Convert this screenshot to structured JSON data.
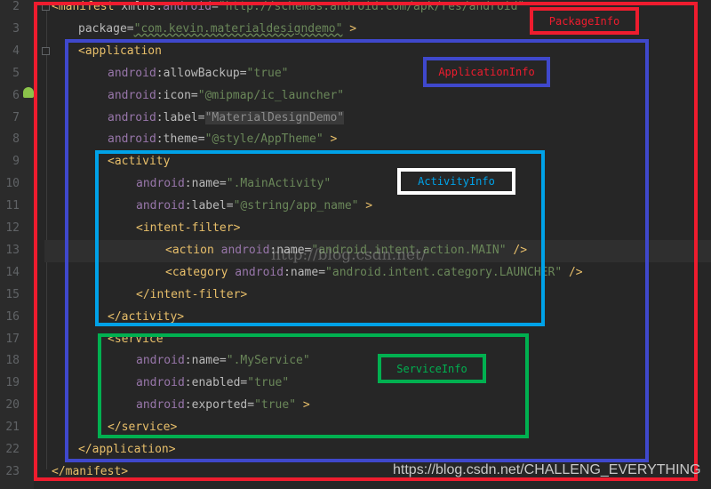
{
  "editor": {
    "lines": [
      {
        "num": "2",
        "indent": 0,
        "tokens": [
          [
            "tag",
            "<manifest "
          ],
          [
            "attr",
            "xmlns:"
          ],
          [
            "ns",
            "android"
          ],
          [
            "attr",
            "="
          ],
          [
            "val",
            "\"http://schemas.android.com/apk/res/android\""
          ]
        ]
      },
      {
        "num": "3",
        "indent": 1,
        "tokens": [
          [
            "attr",
            "package="
          ],
          [
            "val",
            "\"com.kevin.materialdesigndemo\""
          ],
          [
            "tag",
            " >"
          ]
        ]
      },
      {
        "num": "4",
        "indent": 1,
        "tokens": [
          [
            "tag",
            "<application"
          ]
        ]
      },
      {
        "num": "5",
        "indent": 2,
        "tokens": [
          [
            "ns",
            "android"
          ],
          [
            "attr",
            ":allowBackup="
          ],
          [
            "val",
            "\"true\""
          ]
        ]
      },
      {
        "num": "6",
        "indent": 2,
        "tokens": [
          [
            "ns",
            "android"
          ],
          [
            "attr",
            ":icon="
          ],
          [
            "val",
            "\"@mipmap/ic_launcher\""
          ]
        ]
      },
      {
        "num": "7",
        "indent": 2,
        "tokens": [
          [
            "ns",
            "android"
          ],
          [
            "attr",
            ":label="
          ],
          [
            "valgrey",
            "\"MaterialDesignDemo\""
          ]
        ]
      },
      {
        "num": "8",
        "indent": 2,
        "tokens": [
          [
            "ns",
            "android"
          ],
          [
            "attr",
            ":theme="
          ],
          [
            "val",
            "\"@style/AppTheme\""
          ],
          [
            "tag",
            " >"
          ]
        ]
      },
      {
        "num": "9",
        "indent": 2,
        "tokens": [
          [
            "tag",
            "<activity"
          ]
        ]
      },
      {
        "num": "10",
        "indent": 3,
        "tokens": [
          [
            "ns",
            "android"
          ],
          [
            "attr",
            ":name="
          ],
          [
            "val",
            "\".MainActivity\""
          ]
        ]
      },
      {
        "num": "11",
        "indent": 3,
        "tokens": [
          [
            "ns",
            "android"
          ],
          [
            "attr",
            ":label="
          ],
          [
            "val",
            "\"@string/app_name\""
          ],
          [
            "tag",
            " >"
          ]
        ]
      },
      {
        "num": "12",
        "indent": 3,
        "tokens": [
          [
            "tag",
            "<intent-filter>"
          ]
        ]
      },
      {
        "num": "13",
        "indent": 4,
        "tokens": [
          [
            "tag",
            "<action "
          ],
          [
            "ns",
            "android"
          ],
          [
            "attr",
            ":name="
          ],
          [
            "val",
            "\"android.intent.action.MAIN\""
          ],
          [
            "tag",
            " />"
          ]
        ]
      },
      {
        "num": "14",
        "indent": 4,
        "tokens": [
          [
            "tag",
            "<category "
          ],
          [
            "ns",
            "android"
          ],
          [
            "attr",
            ":name="
          ],
          [
            "val",
            "\"android.intent.category.LAUNCHER\""
          ],
          [
            "tag",
            " />"
          ]
        ]
      },
      {
        "num": "15",
        "indent": 3,
        "tokens": [
          [
            "tag",
            "</intent-filter>"
          ]
        ]
      },
      {
        "num": "16",
        "indent": 2,
        "tokens": [
          [
            "tag",
            "</activity>"
          ]
        ]
      },
      {
        "num": "17",
        "indent": 2,
        "tokens": [
          [
            "tag",
            "<service"
          ]
        ]
      },
      {
        "num": "18",
        "indent": 3,
        "tokens": [
          [
            "ns",
            "android"
          ],
          [
            "attr",
            ":name="
          ],
          [
            "val",
            "\".MyService\""
          ]
        ]
      },
      {
        "num": "19",
        "indent": 3,
        "tokens": [
          [
            "ns",
            "android"
          ],
          [
            "attr",
            ":enabled="
          ],
          [
            "val",
            "\"true\""
          ]
        ]
      },
      {
        "num": "20",
        "indent": 3,
        "tokens": [
          [
            "ns",
            "android"
          ],
          [
            "attr",
            ":exported="
          ],
          [
            "val",
            "\"true\""
          ],
          [
            "tag",
            " >"
          ]
        ]
      },
      {
        "num": "21",
        "indent": 2,
        "tokens": [
          [
            "tag",
            "</service>"
          ]
        ]
      },
      {
        "num": "22",
        "indent": 1,
        "tokens": [
          [
            "tag",
            "</application>"
          ]
        ]
      },
      {
        "num": "23",
        "indent": 0,
        "tokens": [
          [
            "tag",
            "</manifest>"
          ]
        ]
      }
    ],
    "current_line": "13"
  },
  "annotations": {
    "package": {
      "label": "PackageInfo",
      "color": "#ee1c2e"
    },
    "application": {
      "label": "ApplicationInfo",
      "color": "#3f48cc"
    },
    "activity": {
      "label": "ActivityInfo",
      "color": "#00a2e8",
      "label_border": "#ffffff"
    },
    "service": {
      "label": "ServiceInfo",
      "color": "#00b050"
    }
  },
  "watermark": "http://blog.csdn.net/",
  "credit": "https://blog.csdn.net/CHALLENG_EVERYTHING"
}
